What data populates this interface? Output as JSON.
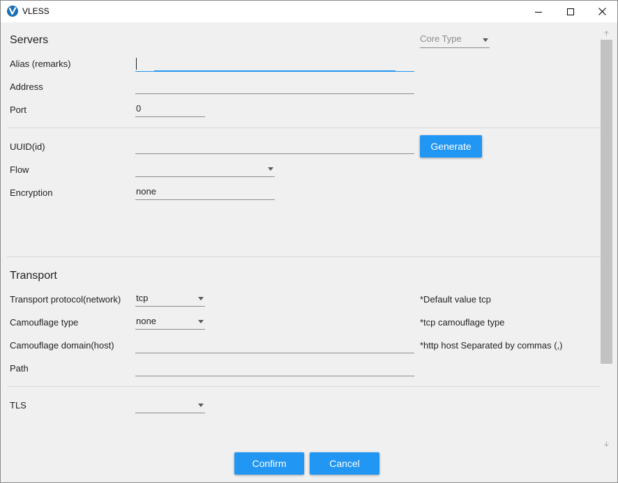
{
  "window": {
    "title": "VLESS",
    "logo_color": "#1e6fb4",
    "controls": [
      "minimize-icon",
      "maximize-icon",
      "close-icon"
    ]
  },
  "servers": {
    "section_title": "Servers",
    "core_type_placeholder": "Core Type",
    "alias_label": "Alias (remarks)",
    "alias_value": "",
    "address_label": "Address",
    "address_value": "",
    "port_label": "Port",
    "port_value": "0"
  },
  "user": {
    "uuid_label": "UUID(id)",
    "uuid_value": "",
    "generate_label": "Generate",
    "flow_label": "Flow",
    "flow_value": "",
    "encryption_label": "Encryption",
    "encryption_value": "none"
  },
  "transport": {
    "section_title": "Transport",
    "network_label": "Transport protocol(network)",
    "network_value": "tcp",
    "network_hint": "*Default value tcp",
    "camouflage_type_label": "Camouflage type",
    "camouflage_type_value": "none",
    "camouflage_type_hint": "*tcp camouflage type",
    "host_label": "Camouflage domain(host)",
    "host_value": "",
    "host_hint": "*http host Separated by commas (,)",
    "path_label": "Path",
    "path_value": ""
  },
  "tls": {
    "label": "TLS",
    "value": ""
  },
  "actions": {
    "confirm_label": "Confirm",
    "cancel_label": "Cancel"
  },
  "colors": {
    "accent": "#2196f3",
    "background": "#f0f0f0",
    "titlebar": "#ffffff"
  }
}
